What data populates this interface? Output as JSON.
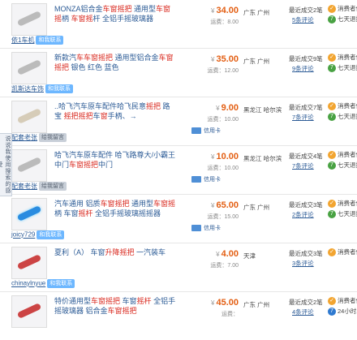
{
  "results": [
    {
      "title_parts": [
        {
          "t": "MONZA铝合金",
          "h": false
        },
        {
          "t": "车窗摇把",
          "h": true
        },
        {
          "t": " 通用型",
          "h": false
        },
        {
          "t": "车窗摇",
          "h": true
        },
        {
          "t": "柄 ",
          "h": false
        },
        {
          "t": "车窗摇",
          "h": true
        },
        {
          "t": "杆 全铝手摇玻璃器",
          "h": false
        }
      ],
      "price": "34.00",
      "shipping_label": "运费：",
      "shipping": "8.00",
      "location": "广东 广州",
      "sales": "最近成交2笔",
      "reviews": "5条评论",
      "shop": "依1车机",
      "shop_badge": "和我联系",
      "badge_style": "blue",
      "credit": "",
      "services": [
        "消费者保障",
        "七天退换"
      ],
      "thumb": "gray"
    },
    {
      "title_parts": [
        {
          "t": "新款汽",
          "h": false
        },
        {
          "t": "车车窗摇把",
          "h": true
        },
        {
          "t": " 通用型铝合金",
          "h": false
        },
        {
          "t": "车窗",
          "h": true
        },
        {
          "t": "摇把",
          "h": true
        },
        {
          "t": " 银色 红色 蓝色",
          "h": false
        }
      ],
      "price": "35.00",
      "shipping_label": "运费：",
      "shipping": "12.00",
      "location": "广东 广州",
      "sales": "最近成交9笔",
      "reviews": "9条评论",
      "shop": "凯斯达车饰",
      "shop_badge": "和我联系",
      "badge_style": "blue",
      "credit": "",
      "services": [
        "消费者保障",
        "七天退换"
      ],
      "thumb": "gray"
    },
    {
      "title_parts": [
        {
          "t": "..哈飞汽车原车配件哈飞民意",
          "h": false
        },
        {
          "t": "摇把",
          "h": true
        },
        {
          "t": " 路宝 ",
          "h": false
        },
        {
          "t": "摇把",
          "h": true
        },
        {
          "t": "摇把",
          "h": true
        },
        {
          "t": "车",
          "h": false
        },
        {
          "t": "窗",
          "h": true
        },
        {
          "t": "手柄、",
          "h": false
        },
        {
          "t": "→",
          "h": false
        }
      ],
      "price": "9.00",
      "shipping_label": "运费：",
      "shipping": "10.00",
      "location": "黑龙江 哈尔滨",
      "sales": "最近成交7笔",
      "reviews": "7条评论",
      "shop": "配套老张",
      "shop_badge": "给我留言",
      "badge_style": "silver",
      "credit": "信用卡",
      "services": [
        "消费者保障",
        "七天退换"
      ],
      "thumb": "beige"
    },
    {
      "title_parts": [
        {
          "t": "哈飞汽车原车配件 哈飞路尊大/小霸王中门",
          "h": false
        },
        {
          "t": "车窗摇把",
          "h": true
        },
        {
          "t": "中门",
          "h": false
        }
      ],
      "price": "10.00",
      "shipping_label": "运费：",
      "shipping": "10.00",
      "location": "黑龙江 哈尔滨",
      "sales": "最近成交4笔",
      "reviews": "7条评论",
      "shop": "配套老张",
      "shop_badge": "给我留言",
      "badge_style": "silver",
      "credit": "信用卡",
      "services": [
        "消费者保障",
        "七天退换"
      ],
      "thumb": "gray"
    },
    {
      "title_parts": [
        {
          "t": "汽车通用 铝质",
          "h": false
        },
        {
          "t": "车窗摇把",
          "h": true
        },
        {
          "t": " 通用型",
          "h": false
        },
        {
          "t": "车窗摇",
          "h": true
        },
        {
          "t": "柄 车窗",
          "h": false
        },
        {
          "t": "摇杆",
          "h": true
        },
        {
          "t": " 全铝手摇玻璃摇摇器",
          "h": false
        }
      ],
      "price": "65.00",
      "shipping_label": "运费：",
      "shipping": "15.00",
      "location": "广东 广州",
      "sales": "最近成交3笔",
      "reviews": "2条评论",
      "shop": "joicy729",
      "shop_badge": "和我联系",
      "badge_style": "blue",
      "credit": "信用卡",
      "services": [
        "消费者保障",
        "七天退换"
      ],
      "thumb": "blueglow"
    },
    {
      "title_parts": [
        {
          "t": "夏利（A） 车窗",
          "h": false
        },
        {
          "t": "升降",
          "h": true
        },
        {
          "t": "摇把",
          "h": true
        },
        {
          "t": " 一汽装车",
          "h": false
        }
      ],
      "price": "4.00",
      "shipping_label": "运费：",
      "shipping": "7.00",
      "location": "天津",
      "sales": "最近成交3笔",
      "reviews": "3条评论",
      "shop": "chinaylnyue",
      "shop_badge": "和我联系",
      "badge_style": "blue",
      "credit": "",
      "services": [
        "消费者保障"
      ],
      "thumb": "red"
    },
    {
      "title_parts": [
        {
          "t": "特价通用型",
          "h": false
        },
        {
          "t": "车窗摇把",
          "h": true
        },
        {
          "t": " 车窗",
          "h": false
        },
        {
          "t": "摇杆",
          "h": true
        },
        {
          "t": " 全铝手摇玻璃器 铝合金",
          "h": false
        },
        {
          "t": "车窗摇把",
          "h": true
        }
      ],
      "price": "45.00",
      "shipping_label": "运费：",
      "shipping": "",
      "location": "广东 广州",
      "sales": "最近成交2笔",
      "reviews": "4条评论",
      "shop": "",
      "shop_badge": "",
      "badge_style": "blue",
      "credit": "",
      "services": [
        "消费者保障",
        "24小时发货"
      ],
      "thumb": "red"
    }
  ],
  "feedback_tab": "说说我使用搜索的感受",
  "yen": "¥",
  "colors": {
    "price": "#e35e12",
    "link": "#2c5b96",
    "highlight": "#d9281e"
  }
}
